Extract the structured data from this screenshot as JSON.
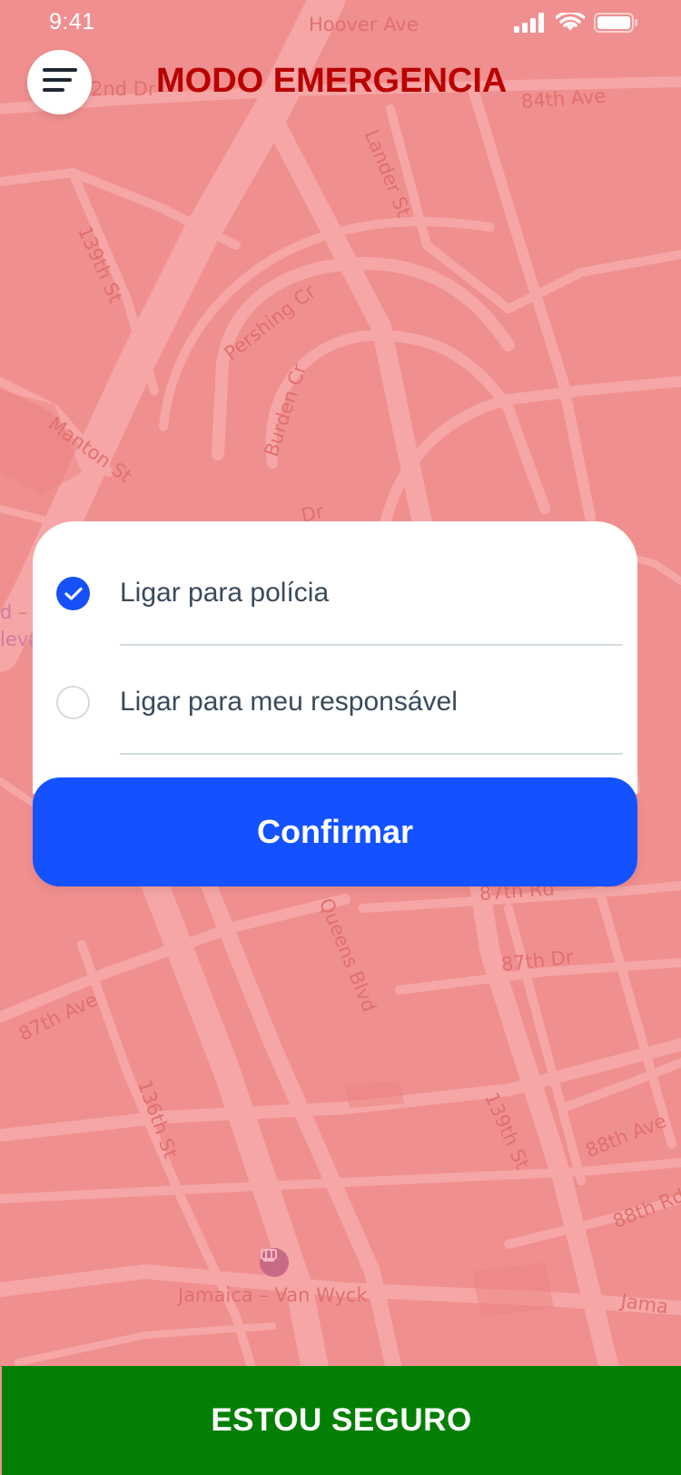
{
  "status_bar": {
    "time": "9:41"
  },
  "header": {
    "title": "MODO EMERGENCIA"
  },
  "options": [
    {
      "label": "Ligar para polícia",
      "checked": true
    },
    {
      "label": "Ligar para meu responsável",
      "checked": false
    }
  ],
  "actions": {
    "confirm_label": "Confirmar",
    "safe_label": "ESTOU SEGURO"
  },
  "map": {
    "labels": {
      "hoover": "Hoover Ave",
      "second_dr": "2nd Dr",
      "ave84": "84th Ave",
      "lander": "Lander St",
      "st139_top": "139th St",
      "pershing": "Pershing Cr",
      "burden": "Burden Cr",
      "manton": "Manton St",
      "dr": "Dr",
      "rd": "Rd",
      "rd87": "87th Rd",
      "queens": "Queens Blvd",
      "dr87": "87th Dr",
      "ave87": "87th Ave",
      "st136": "136th St",
      "st139_bottom": "139th St",
      "ave88": "88th Ave",
      "rd88": "88th Rd",
      "jamaica_vw": "Jamaica – Van Wyck",
      "jama": "Jama",
      "cut1": "d – V",
      "cut2": "leva"
    }
  },
  "colors": {
    "map_bg": "#f08f8f",
    "title": "#b80000",
    "primary": "#1452ff",
    "safe": "#038003"
  },
  "icons": {
    "menu": "menu-icon",
    "check": "check-icon",
    "signal": "signal-icon",
    "wifi": "wifi-icon",
    "battery": "battery-icon",
    "subway": "subway-icon"
  }
}
